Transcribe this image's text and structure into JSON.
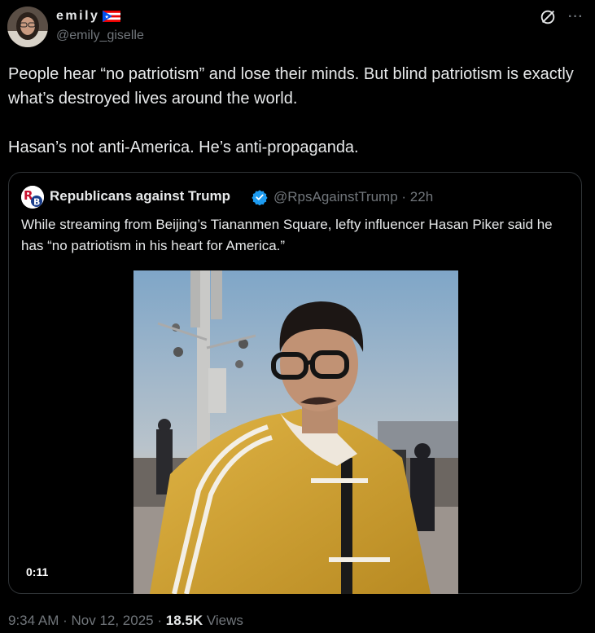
{
  "author": {
    "display_name": "emily",
    "flag_icon": "puerto-rico-flag-icon",
    "handle": "@emily_giselle"
  },
  "tweet": {
    "paragraph_1": "People hear “no patriotism” and lose their minds. But blind patriotism is exactly what’s destroyed lives around the world.",
    "paragraph_2": "Hasan’s not anti-America. He’s anti-propaganda."
  },
  "quote": {
    "display_name": "Republicans against Trump",
    "handle": "@RpsAgainstTrump",
    "separator": " · ",
    "time": "22h",
    "text": "While streaming from Beijing’s Tiananmen Square, lefty influencer Hasan Piker said he has “no patriotism in his heart for America.”",
    "video_duration": "0:11"
  },
  "footer": {
    "time": "9:34 AM",
    "separator1": " · ",
    "date": "Nov 12, 2025",
    "separator2": " · ",
    "views_count": "18.5K",
    "views_label": " Views"
  },
  "colors": {
    "background": "#000000",
    "text_primary": "#e7e9ea",
    "text_secondary": "#71767b",
    "border": "#2f3336",
    "verified": "#1d9bf0",
    "jacket": "#d4a531"
  }
}
